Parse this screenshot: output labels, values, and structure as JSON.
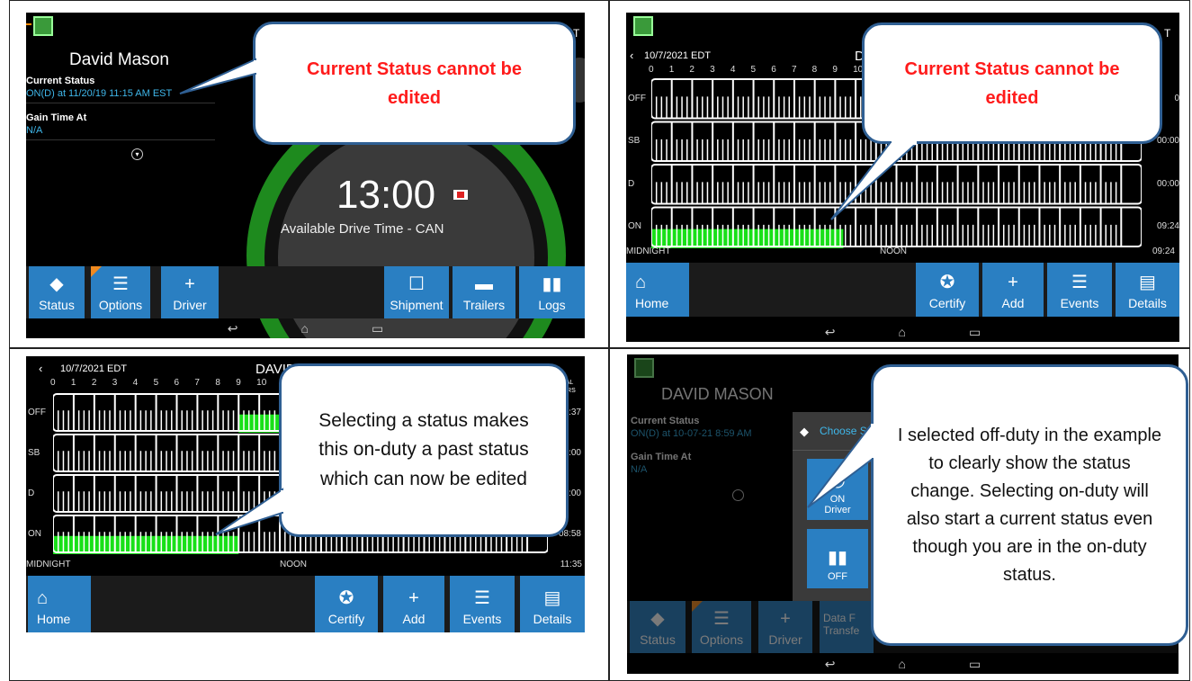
{
  "callouts": {
    "q1": "Current Status cannot be edited",
    "q2": "Current Status cannot be edited",
    "q3": "Selecting a status makes this on-duty a past status which can now be edited",
    "q4": "I selected off-duty in the example to clearly show the status change. Selecting on-duty will also start a current status even though you are in the on-duty status."
  },
  "q1": {
    "driver_name": "David Mason",
    "top_right": "ST",
    "current_status_label": "Current Status",
    "current_status_value": "ON(D) at 11/20/19 11:15 AM EST",
    "gain_time_label": "Gain Time At",
    "gain_time_value": "N/A",
    "time": "13:00",
    "gauge_label": "Available Drive Time - CAN",
    "buttons": [
      "Status",
      "Options",
      "Driver",
      "Shipment",
      "Trailers",
      "Logs"
    ]
  },
  "q2": {
    "date": "10/7/2021 EDT",
    "header_name": "D",
    "top_right": "T",
    "hours": [
      "0",
      "1",
      "2",
      "3",
      "4",
      "5",
      "6",
      "7",
      "8",
      "9",
      "10"
    ],
    "rows": [
      "OFF",
      "SB",
      "D",
      "ON"
    ],
    "totals": [
      "0",
      "00:00",
      "00:00",
      "09:24"
    ],
    "bottom_total": "09:24",
    "midnight": "MIDNIGHT",
    "noon": "NOON",
    "buttons": [
      "Home",
      "Certify",
      "Add",
      "Events",
      "Details"
    ]
  },
  "q3": {
    "date": "10/7/2021 EDT",
    "header_name": "DAVID MASON",
    "total_hdr": [
      "TAL",
      "URS"
    ],
    "hours": [
      "0",
      "1",
      "2",
      "3",
      "4",
      "5",
      "6",
      "7",
      "8",
      "9",
      "10"
    ],
    "rows": [
      "OFF",
      "SB",
      "D",
      "ON"
    ],
    "totals": [
      "2:37",
      "0:00",
      "0:00",
      "08:58"
    ],
    "bottom_total": "11:35",
    "midnight": "MIDNIGHT",
    "noon": "NOON",
    "buttons": [
      "Home",
      "Certify",
      "Add",
      "Events",
      "Details"
    ]
  },
  "q4": {
    "driver_name": "DAVID MASON",
    "current_status_label": "Current Status",
    "current_status_value": "ON(D) at 10-07-21 8:59 AM",
    "gain_time_label": "Gain Time At",
    "gain_time_value": "N/A",
    "dialog_title": "Choose St",
    "on_driver_label": [
      "ON",
      "Driver"
    ],
    "off_label": "OFF",
    "buttons": [
      "Status",
      "Options",
      "Driver"
    ],
    "data_transfer": [
      "Data F",
      "Transfe"
    ]
  },
  "colors": {
    "accent": "#2a7fc2",
    "green": "#18e018",
    "red_text": "#ff1b1b"
  }
}
